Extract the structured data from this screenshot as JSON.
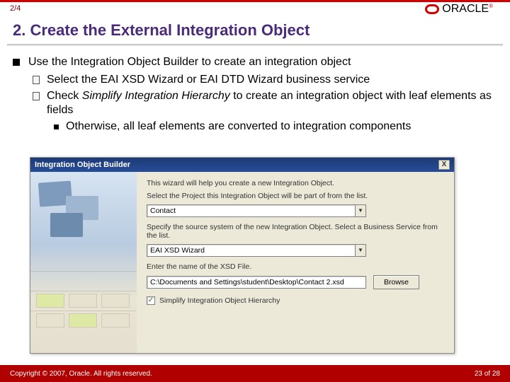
{
  "header": {
    "page_indicator": "2/4",
    "logo_text": "ORACLE"
  },
  "title": "2. Create the External Integration Object",
  "bullets": {
    "l1": "Use the Integration Object Builder to create an integration object",
    "l2a": "Select the EAI XSD Wizard or EAI DTD Wizard business service",
    "l2b_pre": "Check ",
    "l2b_em": "Simplify Integration Hierarchy",
    "l2b_post": " to create an integration object with leaf elements as fields",
    "l3": "Otherwise, all leaf elements are converted to integration components"
  },
  "wizard": {
    "title": "Integration Object Builder",
    "close": "X",
    "intro": "This wizard will help you create a new Integration Object.",
    "project_label": "Select the Project this Integration Object will be part of from the list.",
    "project_value": "Contact",
    "source_label": "Specify the source system of the new Integration Object. Select a Business Service from the list.",
    "source_value": "EAI XSD Wizard",
    "file_label": "Enter the name of the XSD File.",
    "file_value": "C:\\Documents and Settings\\student\\Desktop\\Contact 2.xsd",
    "browse_btn": "Browse",
    "checkbox_mark": "✓",
    "checkbox_label": "Simplify Integration Object Hierarchy"
  },
  "footer": {
    "copyright": "Copyright © 2007, Oracle. All rights reserved.",
    "page": "23 of 28"
  }
}
